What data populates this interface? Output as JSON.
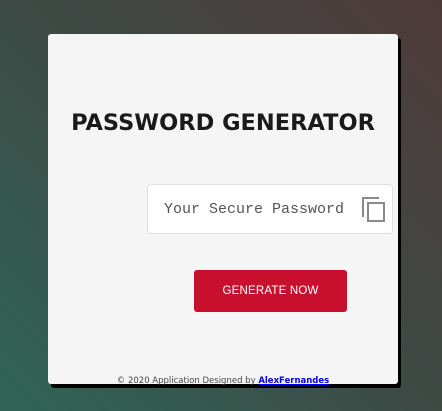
{
  "app": {
    "title": "PASSWORD GENERATOR"
  },
  "password_field": {
    "placeholder": "Your Secure Password",
    "value": ""
  },
  "copy": {
    "icon": "copy-icon"
  },
  "generate_button": {
    "label": "GENERATE NOW",
    "color": "#c8102e"
  },
  "footer": {
    "text": "© 2020 Application Designed by ",
    "link_text": "AlexFernandes"
  }
}
